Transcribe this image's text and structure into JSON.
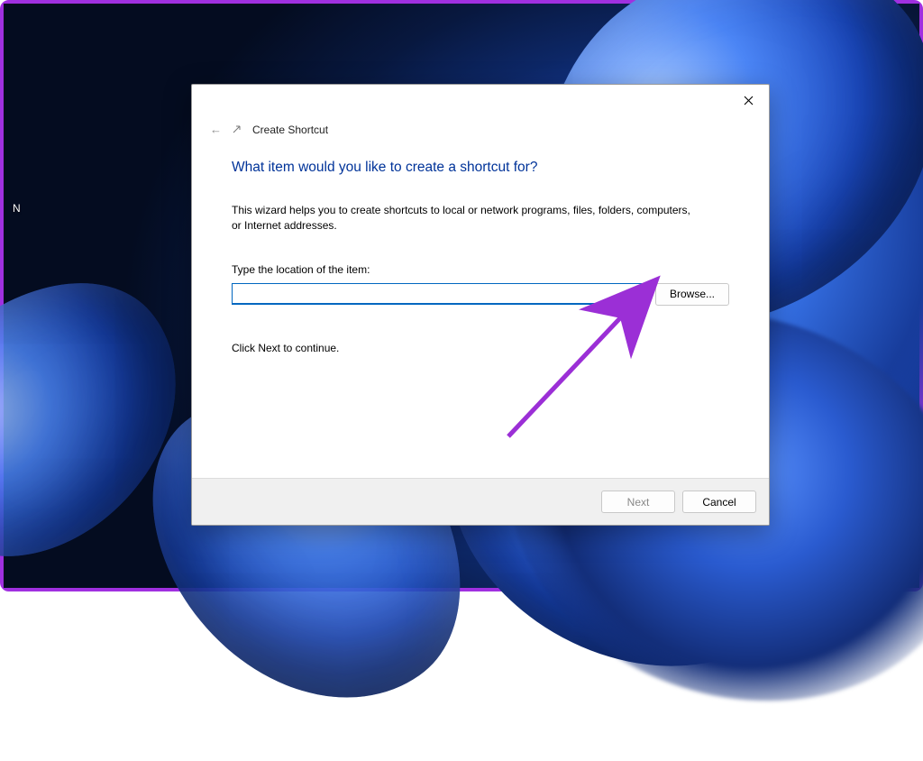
{
  "dialog": {
    "title": "Create Shortcut",
    "heading": "What item would you like to create a shortcut for?",
    "description": "This wizard helps you to create shortcuts to local or network programs, files, folders, computers, or Internet addresses.",
    "location_label": "Type the location of the item:",
    "location_value": "",
    "browse_label": "Browse...",
    "continue_hint": "Click Next to continue.",
    "next_label": "Next",
    "cancel_label": "Cancel"
  },
  "desktop": {
    "partial_label": "N"
  },
  "annotation": {
    "arrow_color": "#9b2fd6"
  }
}
